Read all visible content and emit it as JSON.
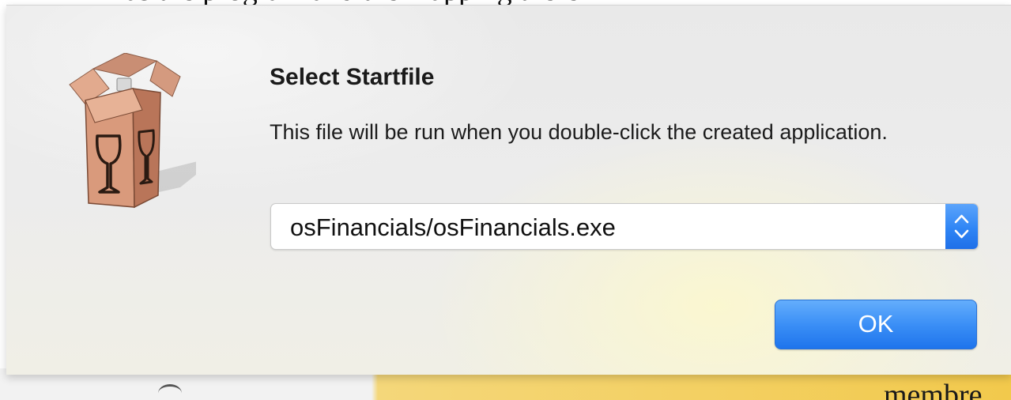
{
  "background": {
    "top_text": "has the program and the mapping there",
    "bottom_text": "membre"
  },
  "dialog": {
    "icon": "wine-bottle-box-icon",
    "title": "Select Startfile",
    "message": "This file will be run when you double-click the created application.",
    "startfile_popup": {
      "selected_value": "osFinancials/osFinancials.exe",
      "stepper_icon": "up-down-chevron-icon"
    },
    "ok_label": "OK"
  },
  "colors": {
    "accent": "#2f85f5",
    "dialog_bg": "#ececec",
    "background_window": "#f2c94c"
  }
}
